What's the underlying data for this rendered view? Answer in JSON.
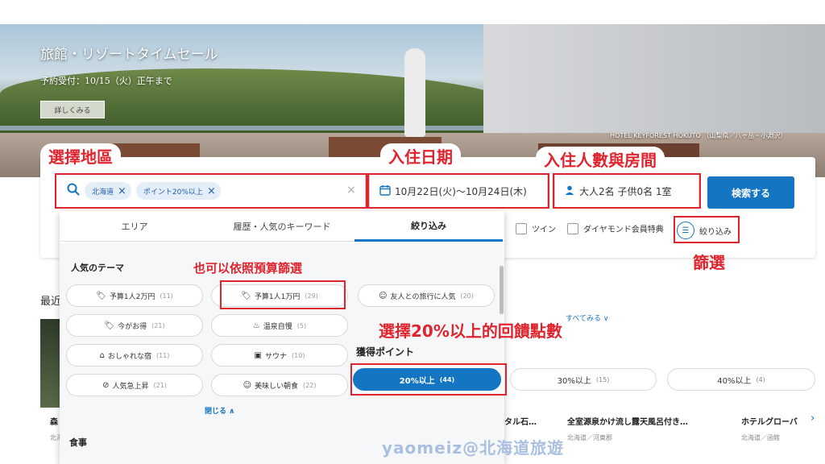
{
  "hero": {
    "title": "旅館・リゾートタイムセール",
    "subtitle": "予約受付：10/15（火）正午まで",
    "details_button": "詳しくみる",
    "caption": "HOTEL KEYFOREST HOKUTO （山梨県／八ヶ岳・小淵沢）"
  },
  "search": {
    "chips": [
      {
        "label": "北海道"
      },
      {
        "label": "ポイント20%以上"
      }
    ],
    "clear_label": "×",
    "dates": "10月22日(火)〜10月24日(木)",
    "guests": "大人2名 子供0名 1室",
    "search_button": "検索する"
  },
  "annotations": {
    "region": "選擇地區",
    "checkin": "入住日期",
    "guests": "入住人數與房間",
    "filter": "篩選",
    "budget": "也可以依照預算篩選",
    "points": "選擇20%以上的回饋點數"
  },
  "filters": {
    "twin": "ツイン",
    "diamond": "ダイヤモンド会員特典",
    "narrow": "絞り込み"
  },
  "dropdown": {
    "tabs": [
      {
        "label": "エリア"
      },
      {
        "label": "履歴・人気のキーワード"
      },
      {
        "label": "絞り込み"
      }
    ],
    "theme_title": "人気のテーマ",
    "themes": [
      {
        "icon": "🏷",
        "label": "予算1人2万円",
        "count": "(11)"
      },
      {
        "icon": "🏷",
        "label": "予算1人1万円",
        "count": "(29)"
      },
      {
        "icon": "☺",
        "label": "友人との旅行に人気",
        "count": "(20)"
      },
      {
        "icon": "🏷",
        "label": "今がお得",
        "count": "(21)"
      },
      {
        "icon": "♨",
        "label": "温泉自慢",
        "count": "(5)"
      },
      {
        "icon": "⌂",
        "label": "おしゃれな宿",
        "count": "(11)"
      },
      {
        "icon": "▣",
        "label": "サウナ",
        "count": "(10)"
      },
      {
        "icon": "⊘",
        "label": "人気急上昇",
        "count": "(21)"
      },
      {
        "icon": "☺",
        "label": "美味しい朝食",
        "count": "(22)"
      }
    ],
    "close_label": "閉じる ∧",
    "food_title": "食事"
  },
  "points": {
    "title": "獲得ポイント",
    "options": [
      {
        "label": "20%以上",
        "count": "(44)"
      },
      {
        "label": "30%以上",
        "count": "(15)"
      },
      {
        "label": "40%以上",
        "count": "(4)"
      }
    ]
  },
  "recent": {
    "label": "最近",
    "more_link": "すべてみる ∨",
    "hotels": [
      {
        "name": "森",
        "loc": "北海"
      },
      {
        "name": "タル石…",
        "loc": ""
      },
      {
        "name": "全室源泉かけ流し露天風呂付き…",
        "loc": "北海道／河東郡"
      },
      {
        "name": "ホテルグローバ",
        "loc": "北海道／函館"
      }
    ]
  },
  "watermark": "yaomeiz@北海道旅遊"
}
